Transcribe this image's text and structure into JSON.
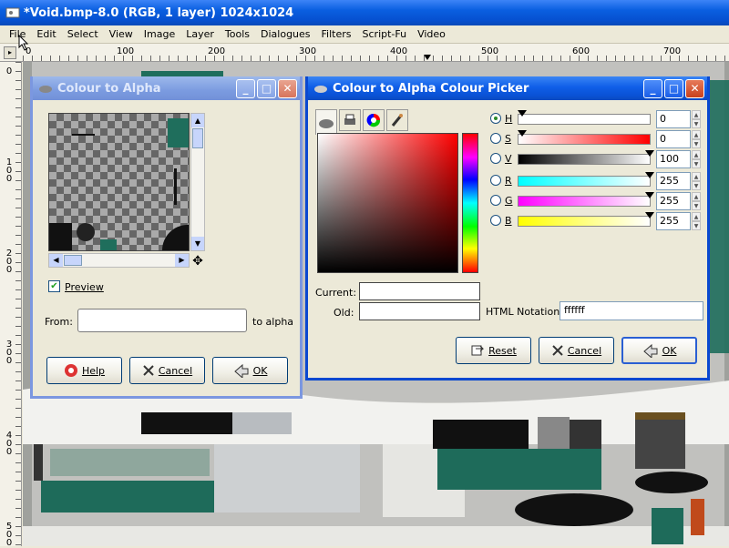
{
  "app": {
    "title": "*Void.bmp-8.0 (RGB, 1 layer) 1024x1024",
    "menu": [
      "File",
      "Edit",
      "Select",
      "View",
      "Image",
      "Layer",
      "Tools",
      "Dialogues",
      "Filters",
      "Script-Fu",
      "Video"
    ]
  },
  "rulers": {
    "top": [
      "0",
      "100",
      "200",
      "300",
      "400",
      "500",
      "600",
      "700"
    ],
    "left": [
      "0",
      "100",
      "200",
      "300",
      "400",
      "500"
    ]
  },
  "c2a": {
    "title": "Colour to Alpha",
    "preview_label": "Preview",
    "preview_checked": true,
    "from_label": "From:",
    "to_label": "to alpha",
    "help": "Help",
    "cancel": "Cancel",
    "ok": "OK"
  },
  "picker": {
    "title": "Colour to Alpha Colour Picker",
    "channels": [
      {
        "label": "H",
        "value": "0",
        "selected": true,
        "grad": "linear-gradient(90deg,#fff,#fff)"
      },
      {
        "label": "S",
        "value": "0",
        "selected": false,
        "grad": "linear-gradient(90deg,#fff,#f00)"
      },
      {
        "label": "V",
        "value": "100",
        "selected": false,
        "grad": "linear-gradient(90deg,#000,#fff)"
      },
      {
        "label": "R",
        "value": "255",
        "selected": false,
        "grad": "linear-gradient(90deg,#0ff,#fff)"
      },
      {
        "label": "G",
        "value": "255",
        "selected": false,
        "grad": "linear-gradient(90deg,#f0f,#fff)"
      },
      {
        "label": "B",
        "value": "255",
        "selected": false,
        "grad": "linear-gradient(90deg,#ff0,#fff)"
      }
    ],
    "current_label": "Current:",
    "old_label": "Old:",
    "html_label": "HTML Notation:",
    "html_value": "ffffff",
    "reset": "Reset",
    "cancel": "Cancel",
    "ok": "OK"
  }
}
